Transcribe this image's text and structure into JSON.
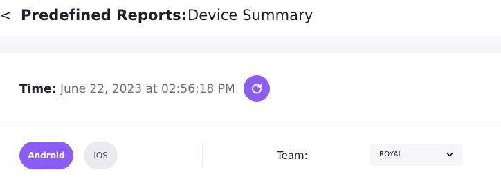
{
  "header": {
    "back_icon": "chevron-left-icon",
    "back_glyph": "<",
    "title": "Predefined Reports:",
    "subtitle": "Device Summary"
  },
  "time": {
    "label": "Time:",
    "value": "June 22, 2023 at 02:56:18 PM",
    "refresh_icon": "refresh-icon"
  },
  "platform_filter": {
    "options": [
      {
        "label": "Android",
        "selected": true
      },
      {
        "label": "IOS",
        "selected": false
      }
    ]
  },
  "team": {
    "label": "Team:",
    "selected_value": "ROYAL",
    "dropdown_icon": "chevron-down-icon"
  },
  "colors": {
    "accent": "#8b5cf6",
    "unselected_pill": "#ebebef",
    "text_primary": "#1e1e2c",
    "text_muted": "#6e6e80"
  }
}
